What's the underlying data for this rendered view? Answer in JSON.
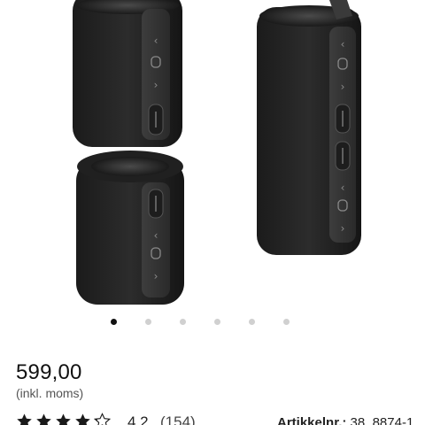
{
  "gallery": {
    "image_description_icon": "speaker-product-image",
    "carousel": {
      "total": 6,
      "active": 1
    }
  },
  "product": {
    "price": "599,00",
    "vat_note": "(inkl. moms)",
    "rating": "4,2",
    "review_count": "(154)",
    "stars_filled": 4.2,
    "article_label": "Artikkelnr.:",
    "article_number": "38_8874-1"
  }
}
